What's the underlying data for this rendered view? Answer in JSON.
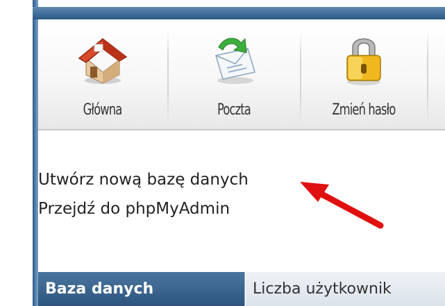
{
  "toolbar": {
    "items": [
      {
        "label": "Główna",
        "icon": "home-icon"
      },
      {
        "label": "Poczta",
        "icon": "mail-icon"
      },
      {
        "label": "Zmień hasło",
        "icon": "padlock-icon"
      }
    ]
  },
  "content": {
    "create_db_link": "Utwórz nową bazę danych",
    "phpmyadmin_link": "Przejdź do phpMyAdmin"
  },
  "annotation": {
    "arrow_color": "#e01010"
  },
  "table": {
    "columns": [
      "Baza danych",
      "Liczba użytkownik"
    ]
  },
  "colors": {
    "header_blue": "#34608c",
    "accent": "#4a79a8"
  }
}
